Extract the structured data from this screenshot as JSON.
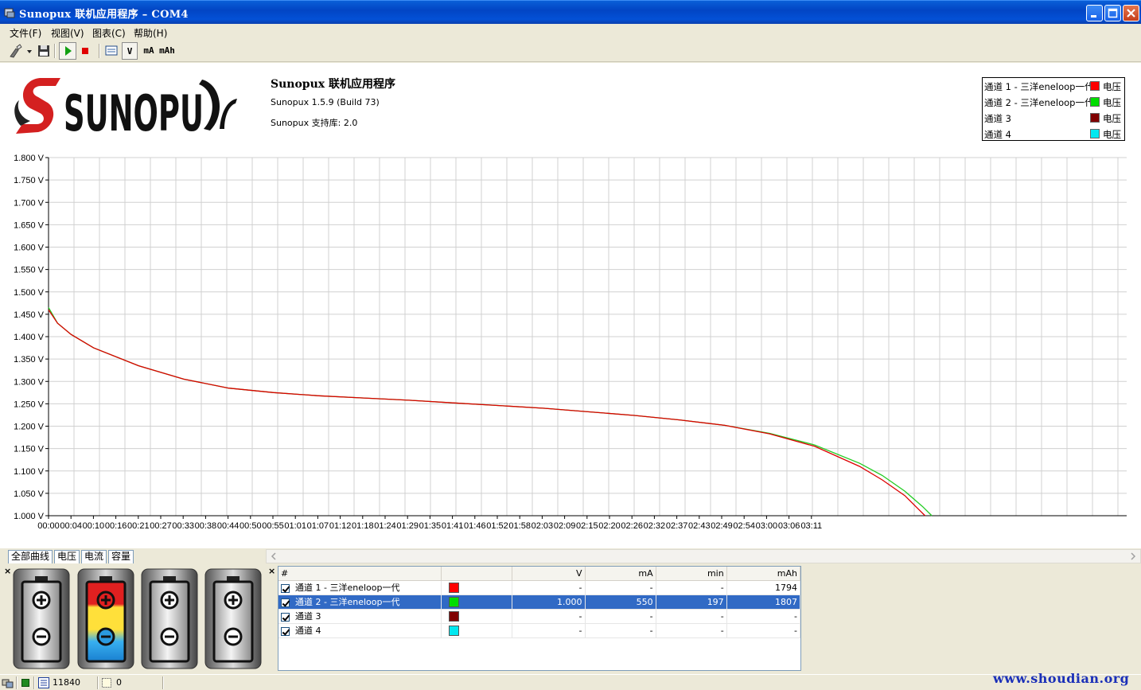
{
  "window": {
    "title": "Sunopux 联机应用程序 – COM4"
  },
  "menu": {
    "items": [
      "文件(F)",
      "视图(V)",
      "图表(C)",
      "帮助(H)"
    ]
  },
  "toolbar": {
    "unit_v": "V",
    "unit_ma": "mA",
    "unit_mah": "mAh",
    "icons": [
      "connect-icon",
      "save-icon",
      "play-icon",
      "stop-icon",
      "chart-view-icon"
    ]
  },
  "header": {
    "logo_text": "SUNOPU",
    "app_title": "Sunopux 联机应用程序",
    "version": "Sunopux 1.5.9 (Build 73)",
    "library": "Sunopux 支持库: 2.0"
  },
  "legend": [
    {
      "name": "通道 1 - 三洋eneloop一代",
      "measure": "电压",
      "color": "#ff0000"
    },
    {
      "name": "通道 2 - 三洋eneloop一代",
      "measure": "电压",
      "color": "#00dd00"
    },
    {
      "name": "通道 3",
      "measure": "电压",
      "color": "#800000"
    },
    {
      "name": "通道 4",
      "measure": "电压",
      "color": "#00e8f0"
    }
  ],
  "chart_data": {
    "type": "line",
    "ylim": [
      1.0,
      1.8
    ],
    "y_ticks": [
      "1.800 V",
      "1.750 V",
      "1.700 V",
      "1.650 V",
      "1.600 V",
      "1.550 V",
      "1.500 V",
      "1.450 V",
      "1.400 V",
      "1.350 V",
      "1.300 V",
      "1.250 V",
      "1.200 V",
      "1.150 V",
      "1.100 V",
      "1.050 V",
      "1.000 V"
    ],
    "x_ticks": [
      "00:00",
      "00:04",
      "00:10",
      "00:16",
      "00:21",
      "00:27",
      "00:33",
      "00:38",
      "00:44",
      "00:50",
      "00:55",
      "01:01",
      "01:07",
      "01:12",
      "01:18",
      "01:24",
      "01:29",
      "01:35",
      "01:41",
      "01:46",
      "01:52",
      "01:58",
      "02:03",
      "02:09",
      "02:15",
      "02:20",
      "02:26",
      "02:32",
      "02:37",
      "02:43",
      "02:49",
      "02:54",
      "03:00",
      "03:06",
      "03:11"
    ],
    "x_unit": "minutes",
    "grid": true,
    "series": [
      {
        "name": "通道 1 - 三洋eneloop一代",
        "color": "#dd0000",
        "x": [
          0,
          2,
          5,
          10,
          20,
          30,
          40,
          50,
          60,
          70,
          80,
          90,
          100,
          110,
          120,
          130,
          140,
          150,
          160,
          170,
          180,
          185,
          190,
          193,
          194.5
        ],
        "y": [
          1.46,
          1.43,
          1.405,
          1.375,
          1.335,
          1.305,
          1.285,
          1.275,
          1.268,
          1.263,
          1.258,
          1.252,
          1.246,
          1.24,
          1.232,
          1.224,
          1.214,
          1.202,
          1.183,
          1.155,
          1.11,
          1.08,
          1.045,
          1.015,
          1.0
        ]
      },
      {
        "name": "通道 2 - 三洋eneloop一代",
        "color": "#22cc22",
        "x": [
          0,
          2,
          5,
          10,
          20,
          30,
          40,
          50,
          60,
          70,
          80,
          90,
          100,
          110,
          120,
          130,
          140,
          150,
          160,
          170,
          180,
          185,
          190,
          194,
          196
        ],
        "y": [
          1.465,
          1.43,
          1.405,
          1.375,
          1.335,
          1.305,
          1.285,
          1.275,
          1.268,
          1.263,
          1.258,
          1.252,
          1.246,
          1.24,
          1.232,
          1.224,
          1.214,
          1.202,
          1.184,
          1.158,
          1.117,
          1.09,
          1.055,
          1.02,
          1.0
        ]
      }
    ]
  },
  "tabs": [
    "全部曲线",
    "电压",
    "电流",
    "容量"
  ],
  "table": {
    "headers": [
      "#",
      "",
      "V",
      "mA",
      "min",
      "mAh"
    ],
    "rows": [
      {
        "name": "通道 1 - 三洋eneloop一代",
        "color": "#ff0000",
        "v": "-",
        "ma": "-",
        "min": "-",
        "mah": "1794"
      },
      {
        "name": "通道 2 - 三洋eneloop一代",
        "color": "#00dd00",
        "v": "1.000",
        "ma": "550",
        "min": "197",
        "mah": "1807"
      },
      {
        "name": "通道 3",
        "color": "#800000",
        "v": "-",
        "ma": "-",
        "min": "-",
        "mah": "-"
      },
      {
        "name": "通道 4",
        "color": "#00e8f0",
        "v": "-",
        "ma": "-",
        "min": "-",
        "mah": "-"
      }
    ]
  },
  "status": {
    "count": "11840",
    "second": "0",
    "watermark": "www.shoudian.org"
  }
}
